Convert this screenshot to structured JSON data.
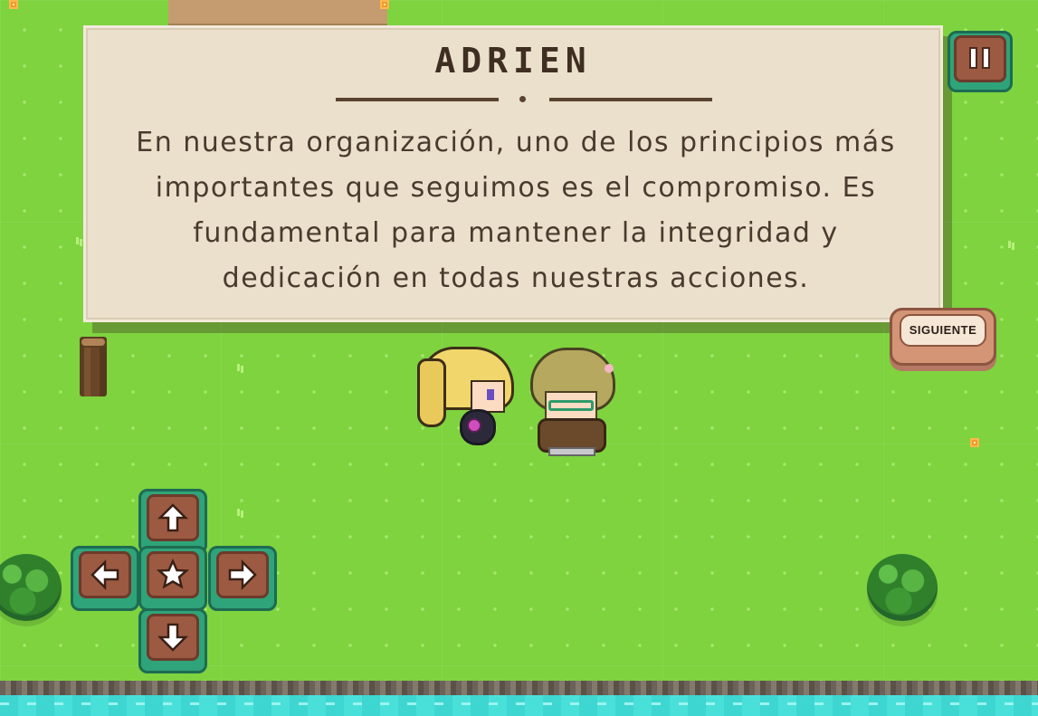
{
  "dialog": {
    "speaker": "ADRIEN",
    "lines": [
      "En nuestra organización, uno de los principios más",
      "importantes que seguimos es el compromiso. Es",
      "fundamental para mantener la integridad y",
      "dedicación en todas nuestras acciones."
    ]
  },
  "buttons": {
    "next_label": "SIGUIENTE",
    "pause_icon": "pause-icon"
  },
  "dpad": {
    "up_icon": "arrow-up-icon",
    "down_icon": "arrow-down-icon",
    "left_icon": "arrow-left-icon",
    "right_icon": "arrow-right-icon",
    "center_icon": "star-icon"
  },
  "colors": {
    "grass": "#7ed33f",
    "dialog_bg": "#ebe0cc",
    "dialog_text": "#4a3a2e",
    "button_face": "#9c5a42",
    "button_base": "#2fa37a",
    "water": "#3ed6d0"
  }
}
